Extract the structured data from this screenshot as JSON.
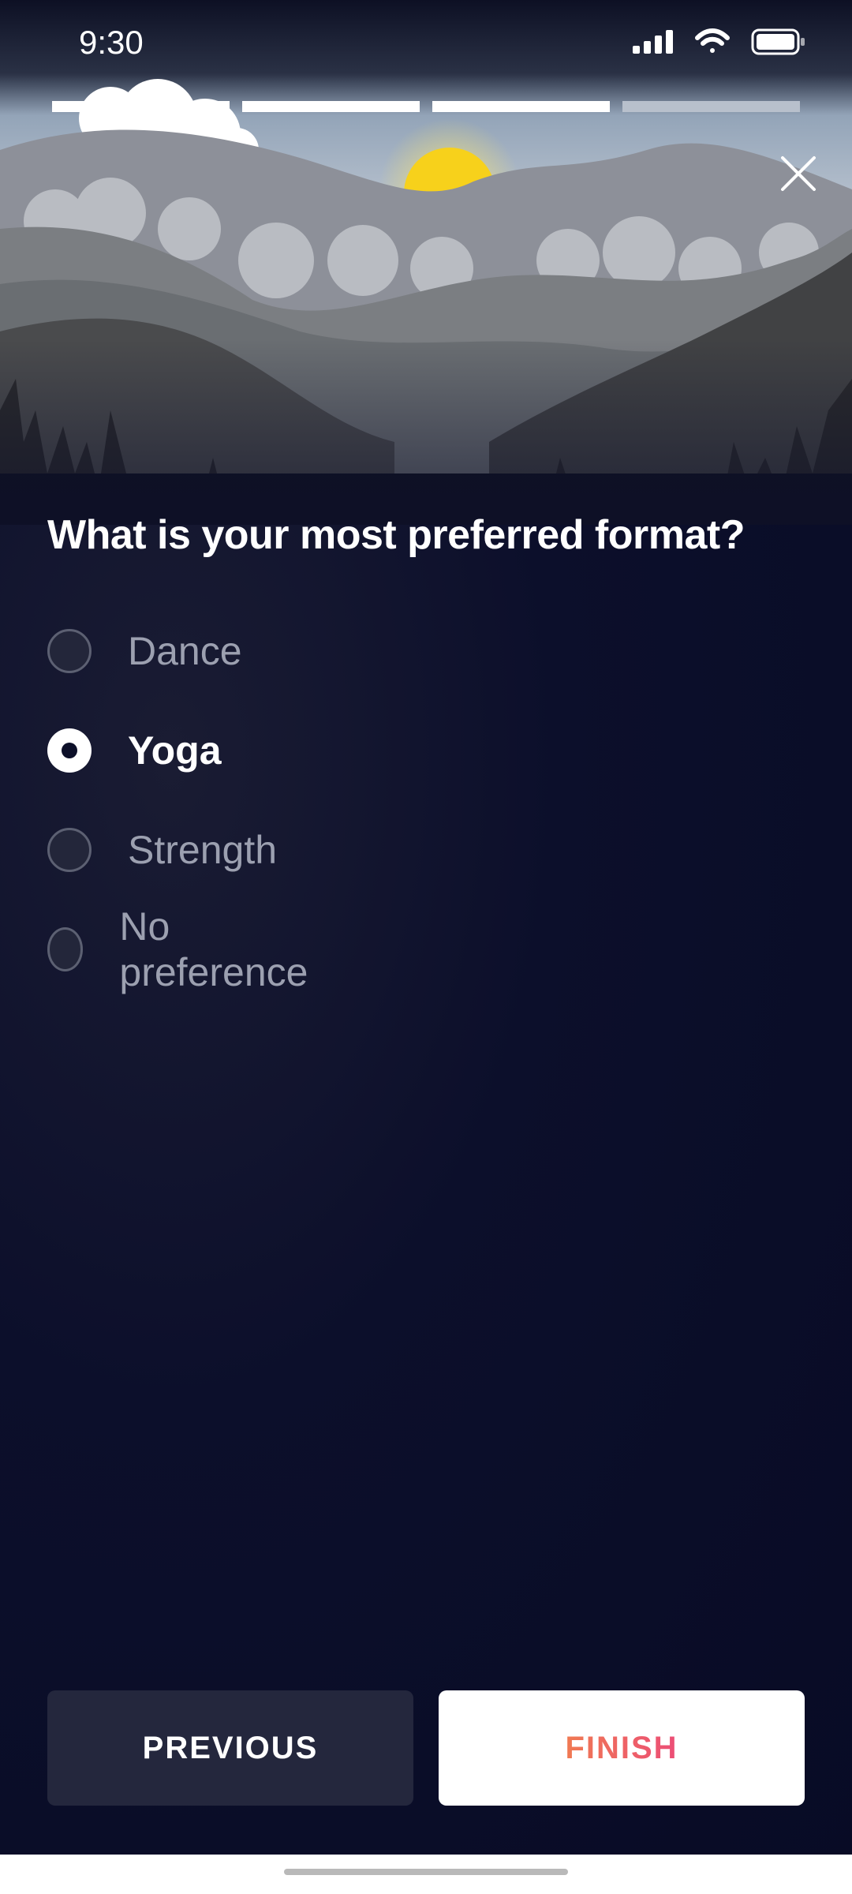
{
  "status": {
    "time": "9:30"
  },
  "progress": {
    "steps_total": 4,
    "steps_done": 3
  },
  "question": "What is your most preferred format?",
  "options": [
    {
      "label": "Dance",
      "selected": false
    },
    {
      "label": "Yoga",
      "selected": true
    },
    {
      "label": "Strength",
      "selected": false
    },
    {
      "label": "No preference",
      "selected": false
    }
  ],
  "buttons": {
    "previous": "PREVIOUS",
    "finish": "FINISH"
  },
  "colors": {
    "background": "#0a0d2a",
    "sun": "#f7d11b",
    "finish_text": "#ee5b6b",
    "prev_button": "#24273d"
  },
  "icons": {
    "close": "close-icon",
    "signal": "signal-icon",
    "wifi": "wifi-icon",
    "battery": "battery-icon"
  }
}
